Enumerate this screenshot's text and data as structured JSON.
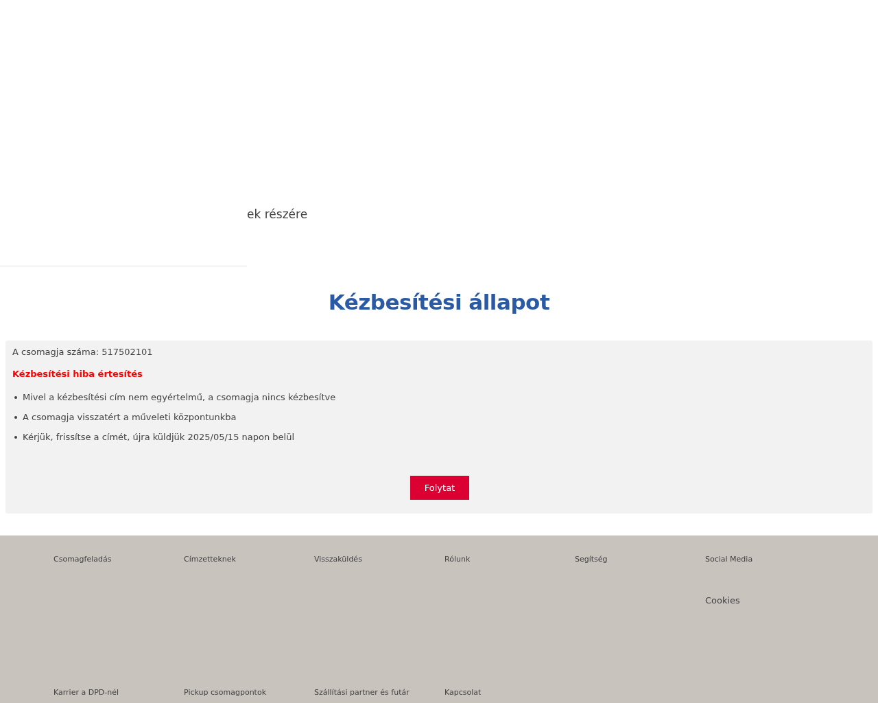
{
  "header": {
    "partial_text": "ek részére"
  },
  "title": "Kézbesítési állapot",
  "card": {
    "parcel_number": "A csomagja száma: 517502101",
    "alert": "Kézbesítési hiba értesítés",
    "bullets": [
      "Mivel a kézbesítési cím nem egyértelmű, a csomagja nincs kézbesítve",
      "A csomagja visszatért a műveleti központunkba",
      "Kérjük, frissítse a címét, újra küldjük 2025/05/15 napon belül"
    ],
    "button": "Folytat"
  },
  "footer": {
    "top_links": [
      "Csomagfeladás",
      "Címzetteknek",
      "Visszaküldés",
      "Rólunk",
      "Segítség",
      "Social Media"
    ],
    "cookies": "Cookies",
    "bottom_links": [
      "Karrier a DPD-nél",
      "Pickup csomagpontok",
      "Szállítási partner és futár",
      "Kapcsolat"
    ]
  }
}
